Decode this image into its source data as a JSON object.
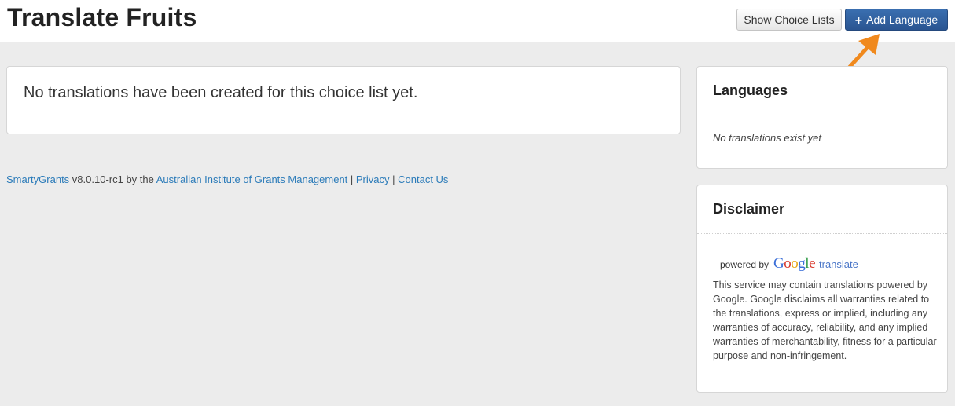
{
  "header": {
    "title": "Translate Fruits",
    "show_choice_lists_label": "Show Choice Lists",
    "add_language_label": "Add Language",
    "add_language_icon": "plus-icon"
  },
  "main": {
    "message": "No translations have been created for this choice list yet."
  },
  "footer": {
    "product_link": "SmartyGrants",
    "version_text": " v8.0.10-rc1 by the ",
    "institute_link": "Australian Institute of Grants Management",
    "separator1": " | ",
    "privacy_link": "Privacy",
    "separator2": " | ",
    "contact_link": "Contact Us"
  },
  "sidebar": {
    "languages": {
      "title": "Languages",
      "empty_text": "No translations exist yet"
    },
    "disclaimer": {
      "title": "Disclaimer",
      "powered_by": "powered by",
      "google_logo_text": "Google",
      "translate_text": "translate",
      "text": "This service may contain translations powered by Google. Google disclaims all warranties related to the translations, express or implied, including any warranties of accuracy, reliability, and any implied warranties of merchantability, fitness for a particular purpose and non-infringement."
    }
  },
  "colors": {
    "accent": "#2a5591",
    "link": "#2b7bb9",
    "arrow": "#f0891d",
    "background": "#ececec"
  }
}
